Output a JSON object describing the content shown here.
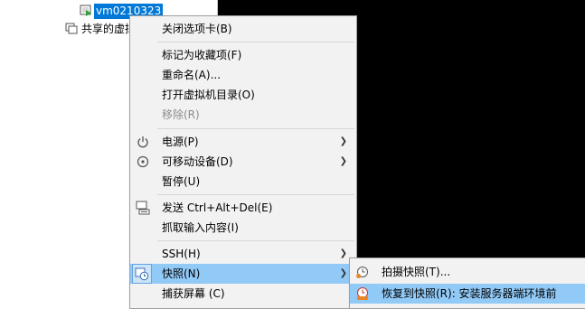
{
  "tree": {
    "vm_name": "vm0210323",
    "shared_label": "共享的虚拟"
  },
  "context_menu": {
    "items": [
      {
        "label": "关闭选项卡(B)",
        "enabled": true
      },
      {
        "label": "标记为收藏项(F)",
        "enabled": true
      },
      {
        "label": "重命名(A)...",
        "enabled": true
      },
      {
        "label": "打开虚拟机目录(O)",
        "enabled": true
      },
      {
        "label": "移除(R)",
        "enabled": false
      },
      {
        "label": "电源(P)",
        "enabled": true,
        "icon": "power-icon",
        "submenu": true
      },
      {
        "label": "可移动设备(D)",
        "enabled": true,
        "icon": "removable-device-icon",
        "submenu": true
      },
      {
        "label": "暂停(U)",
        "enabled": true
      },
      {
        "label": "发送 Ctrl+Alt+Del(E)",
        "enabled": true,
        "icon": "send-keys-icon"
      },
      {
        "label": "抓取输入内容(I)",
        "enabled": true
      },
      {
        "label": "SSH(H)",
        "enabled": true,
        "submenu": true
      },
      {
        "label": "快照(N)",
        "enabled": true,
        "icon": "snapshot-icon",
        "submenu": true,
        "highlighted": true
      },
      {
        "label": "捕获屏幕 (C)",
        "enabled": true
      }
    ]
  },
  "snapshot_submenu": {
    "items": [
      {
        "label": "拍摄快照(T)...",
        "icon": "take-snapshot-icon"
      },
      {
        "label": "恢复到快照(R): 安装服务器端环境前",
        "icon": "revert-snapshot-icon",
        "highlighted": true
      }
    ]
  },
  "colors": {
    "selection": "#0078d7",
    "menu_background": "#f2f2f2",
    "menu_highlight": "#91c9f7",
    "console_background": "#000000"
  }
}
